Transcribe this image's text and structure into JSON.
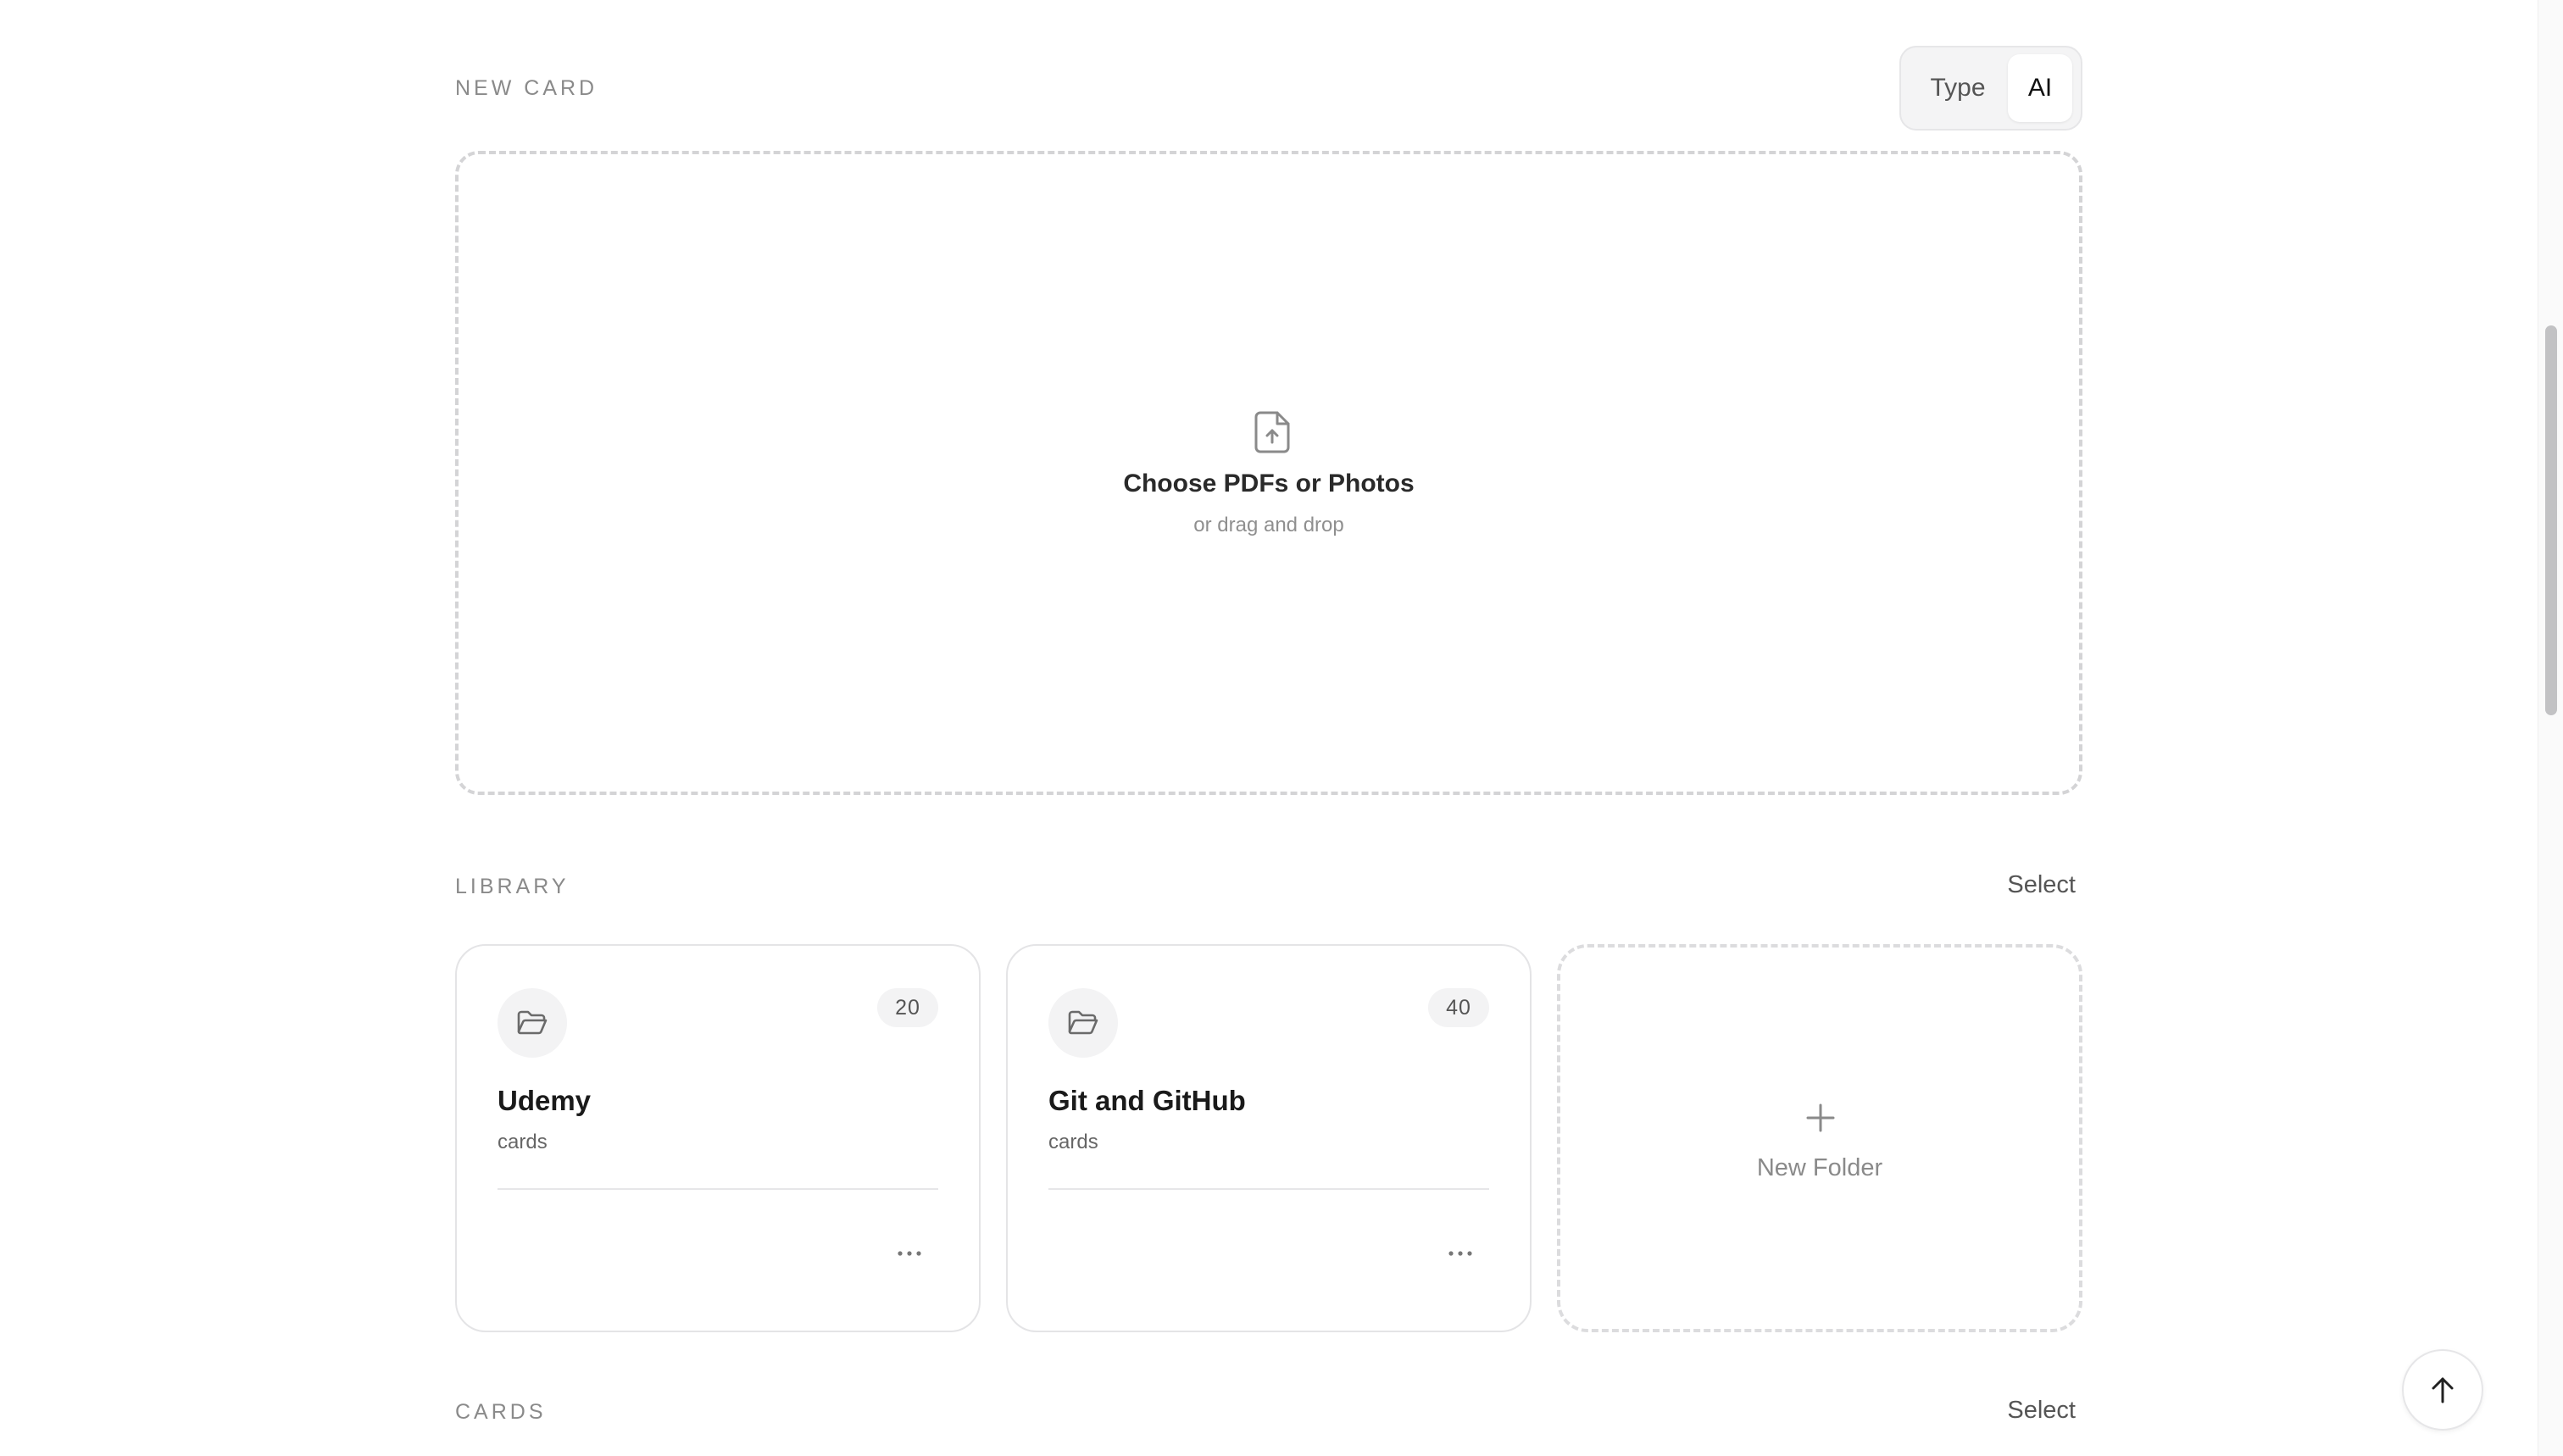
{
  "new_card": {
    "label": "NEW CARD",
    "mode_toggle": {
      "options": [
        "Type",
        "AI"
      ],
      "selected": "AI"
    },
    "dropzone": {
      "icon": "file-upload-icon",
      "title": "Choose PDFs or Photos",
      "subtitle": "or drag and drop"
    }
  },
  "library": {
    "label": "LIBRARY",
    "select_label": "Select",
    "folders": [
      {
        "name": "Udemy",
        "sub": "cards",
        "count": "20"
      },
      {
        "name": "Git and GitHub",
        "sub": "cards",
        "count": "40"
      }
    ],
    "new_folder_label": "New Folder"
  },
  "cards": {
    "label": "CARDS",
    "select_label": "Select"
  },
  "icons": {
    "folder": "folder-open-icon",
    "more": "more-horizontal-icon",
    "plus": "plus-icon",
    "scroll_top": "arrow-up-icon"
  }
}
